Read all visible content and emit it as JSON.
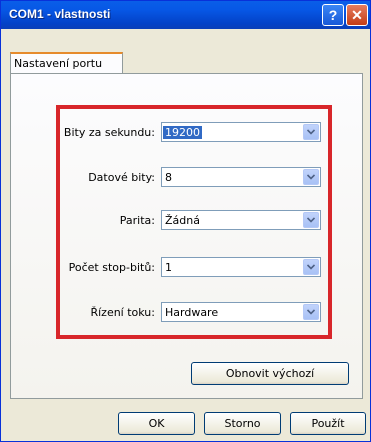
{
  "window": {
    "title": "COM1 - vlastnosti",
    "help_glyph": "?",
    "close_glyph": "✕"
  },
  "tabs": [
    {
      "label": "Nastavení portu",
      "active": true
    }
  ],
  "fields": [
    {
      "label": "Bity za sekundu:",
      "value": "19200",
      "selected": true
    },
    {
      "label": "Datové bity:",
      "value": "8"
    },
    {
      "label": "Parita:",
      "value": "Žádná"
    },
    {
      "label": "Počet stop-bitů:",
      "value": "1"
    },
    {
      "label": "Řízení toku:",
      "value": "Hardware"
    }
  ],
  "buttons": {
    "restore_default": "Obnovit výchozí",
    "ok": "OK",
    "cancel": "Storno",
    "apply": "Použít"
  },
  "colors": {
    "highlight": "#d8262a",
    "titlebar": "#0a5ee8",
    "selection": "#316ac5"
  }
}
